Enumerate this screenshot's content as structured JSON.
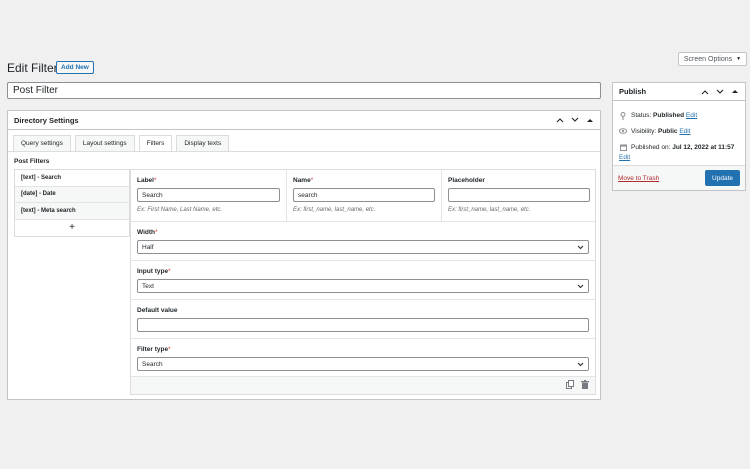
{
  "screen_options": {
    "label": "Screen Options",
    "caret": "▼"
  },
  "page": {
    "title": "Edit Filter",
    "add_new": "Add New"
  },
  "post_title": "Post Filter",
  "directory_settings": {
    "title": "Directory Settings",
    "tabs": [
      "Query settings",
      "Layout settings",
      "Filters",
      "Display texts"
    ],
    "active_tab": "Filters",
    "post_filters_label": "Post Filters",
    "filters": [
      "[text] - Search",
      "[date] - Date",
      "[text] - Meta search"
    ],
    "add_symbol": "+",
    "fields": {
      "label": {
        "label": "Label",
        "value": "Search",
        "hint": "Ex: First Name, Last Name, etc."
      },
      "name": {
        "label": "Name",
        "value": "search",
        "hint": "Ex: first_name, last_name, etc."
      },
      "placeholder": {
        "label": "Placeholder",
        "value": "",
        "hint": "Ex: first_name, last_name, etc."
      },
      "width": {
        "label": "Width",
        "value": "Half"
      },
      "input_type": {
        "label": "Input type",
        "value": "Text"
      },
      "default_value": {
        "label": "Default value",
        "value": ""
      },
      "filter_type": {
        "label": "Filter type",
        "value": "Search"
      }
    },
    "required_mark": "*"
  },
  "publish": {
    "title": "Publish",
    "status_label": "Status:",
    "status_value": "Published",
    "visibility_label": "Visibility:",
    "visibility_value": "Public",
    "published_label": "Published on:",
    "published_value": "Jul 12, 2022 at 11:57",
    "edit": "Edit",
    "trash": "Move to Trash",
    "update": "Update"
  },
  "colors": {
    "accent": "#2271b1",
    "danger": "#b32d2e",
    "required": "#d63638"
  }
}
